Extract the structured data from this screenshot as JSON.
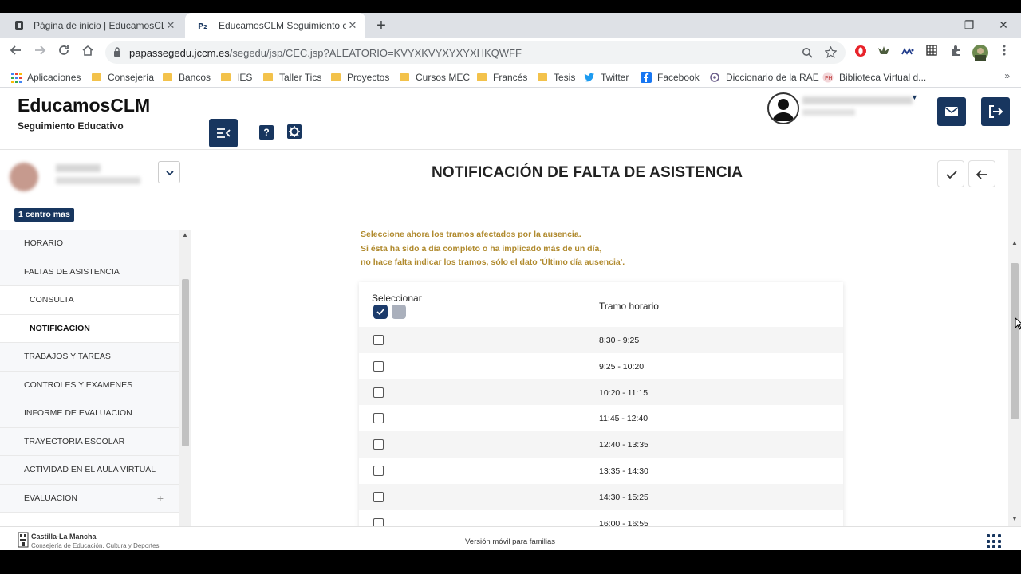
{
  "browser": {
    "tabs": [
      {
        "title": "Página de inicio | EducamosCLM",
        "close": "✕"
      },
      {
        "title": "EducamosCLM Seguimiento edu",
        "close": "✕"
      }
    ],
    "new_tab": "+",
    "window_controls": {
      "minimize": "—",
      "restore": "❐",
      "close": "✕"
    },
    "url_host": "papassegedu.jccm.es",
    "url_path": "/segedu/jsp/CEC.jsp?ALEATORIO=KVYXKVYXYXYXHKQWFF",
    "bookmarks": [
      "Aplicaciones",
      "Consejería",
      "Bancos",
      "IES",
      "Taller Tics",
      "Proyectos",
      "Cursos MEC",
      "Francés",
      "Tesis",
      "Twitter",
      "Facebook",
      "Diccionario de la RAE",
      "Biblioteca Virtual d..."
    ],
    "bookmarks_more": "»"
  },
  "header": {
    "brand": "EducamosCLM",
    "subtitle": "Seguimiento Educativo",
    "help_icon": "?"
  },
  "sidebar": {
    "badge": "1 centro mas",
    "items": [
      {
        "label": "HORARIO",
        "sign": ""
      },
      {
        "label": "FALTAS DE ASISTENCIA",
        "sign": "—"
      },
      {
        "label": "CONSULTA",
        "sign": ""
      },
      {
        "label": "NOTIFICACION",
        "sign": ""
      },
      {
        "label": "TRABAJOS Y TAREAS",
        "sign": ""
      },
      {
        "label": "CONTROLES Y EXAMENES",
        "sign": ""
      },
      {
        "label": "INFORME DE EVALUACION",
        "sign": ""
      },
      {
        "label": "TRAYECTORIA ESCOLAR",
        "sign": ""
      },
      {
        "label": "ACTIVIDAD EN EL AULA VIRTUAL",
        "sign": ""
      },
      {
        "label": "EVALUACION",
        "sign": "+"
      }
    ]
  },
  "main": {
    "title": "NOTIFICACIÓN DE FALTA DE ASISTENCIA",
    "instructions": [
      "Seleccione ahora los tramos afectados por la ausencia.",
      "Si ésta ha sido a día completo o ha implicado más de un día,",
      "no hace falta indicar los tramos, sólo el dato 'Último día ausencia'."
    ],
    "table": {
      "col_select": "Seleccionar",
      "col_tramo": "Tramo horario",
      "rows": [
        "8:30 - 9:25",
        "9:25 - 10:20",
        "10:20 - 11:15",
        "11:45 - 12:40",
        "12:40 - 13:35",
        "13:35 - 14:30",
        "14:30 - 15:25",
        "16:00 - 16:55"
      ]
    }
  },
  "footer": {
    "org_name": "Castilla-La Mancha",
    "org_dept": "Consejería de Educación, Cultura y Deportes",
    "mobile_link": "Versión móvil para familias"
  },
  "colors": {
    "brand_navy": "#18365f",
    "instruction_gold": "#b08a2e"
  }
}
